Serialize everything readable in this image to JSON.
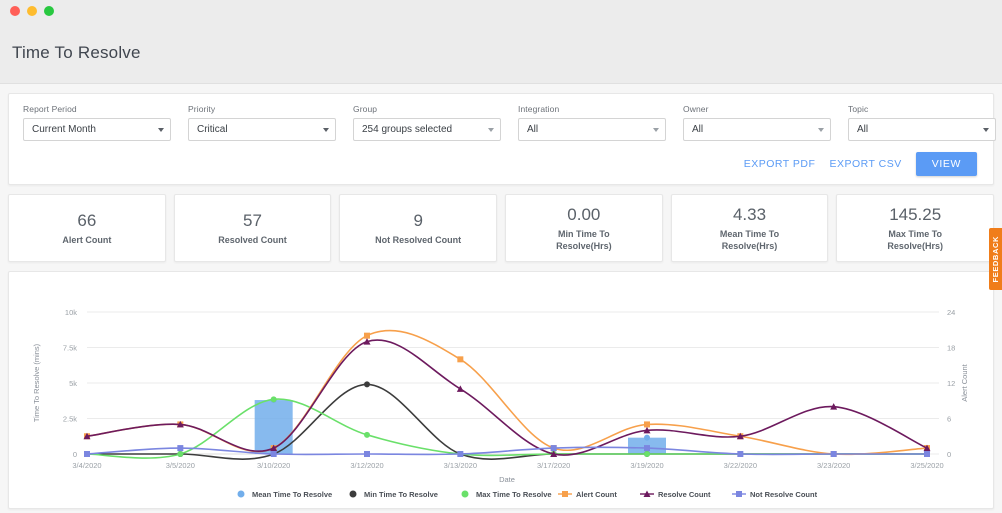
{
  "window": {
    "title": "Time To Resolve",
    "controls": [
      "close",
      "minimize",
      "maximize"
    ]
  },
  "filters": [
    {
      "label": "Report Period",
      "value": "Current Month",
      "caret": "dark"
    },
    {
      "label": "Priority",
      "value": "Critical",
      "caret": "dark"
    },
    {
      "label": "Group",
      "value": "254 groups selected",
      "caret": "light"
    },
    {
      "label": "Integration",
      "value": "All",
      "caret": "light"
    },
    {
      "label": "Owner",
      "value": "All",
      "caret": "light"
    },
    {
      "label": "Topic",
      "value": "All",
      "caret": "dark"
    }
  ],
  "actions": {
    "export_pdf": "EXPORT PDF",
    "export_csv": "EXPORT CSV",
    "view": "VIEW"
  },
  "kpis": [
    {
      "value": "66",
      "label": "Alert Count"
    },
    {
      "value": "57",
      "label": "Resolved Count"
    },
    {
      "value": "9",
      "label": "Not Resolved Count"
    },
    {
      "value": "0.00",
      "label": "Min Time To\nResolve(Hrs)"
    },
    {
      "value": "4.33",
      "label": "Mean Time To\nResolve(Hrs)"
    },
    {
      "value": "145.25",
      "label": "Max Time To\nResolve(Hrs)"
    }
  ],
  "feedback_tab": {
    "label": "FEEDBACK",
    "color": "#f07d1a"
  },
  "chart_data": {
    "type": "line",
    "title": "",
    "xlabel": "Date",
    "ylabel": "Time To Resolve (mins)",
    "y2label": "Alert Count",
    "grid": true,
    "legend_position": "bottom",
    "categories": [
      "3/4/2020",
      "3/5/2020",
      "3/10/2020",
      "3/12/2020",
      "3/13/2020",
      "3/17/2020",
      "3/19/2020",
      "3/22/2020",
      "3/23/2020",
      "3/25/2020"
    ],
    "ylim": [
      0,
      10000
    ],
    "yticks": [
      "0",
      "2.5k",
      "5k",
      "7.5k",
      "10k"
    ],
    "y2lim": [
      0,
      24
    ],
    "y2ticks": [
      "0",
      "6",
      "12",
      "18",
      "24"
    ],
    "series": [
      {
        "name": "Mean Time To Resolve",
        "color": "#72aeeb",
        "type": "bar",
        "marker": "circle",
        "axis": "left",
        "values": [
          0,
          0,
          3800,
          0,
          0,
          0,
          1150,
          0,
          0,
          0
        ]
      },
      {
        "name": "Min Time To Resolve",
        "color": "#3c3c3c",
        "type": "spline",
        "marker": "circle",
        "axis": "left",
        "values": [
          0,
          0,
          0,
          4900,
          0,
          0,
          0,
          0,
          0,
          0
        ]
      },
      {
        "name": "Max Time To Resolve",
        "color": "#6ae06a",
        "type": "spline",
        "marker": "circle",
        "axis": "left",
        "values": [
          0,
          0,
          3850,
          1350,
          0,
          0,
          0,
          0,
          0,
          0
        ]
      },
      {
        "name": "Alert Count",
        "color": "#f7a04b",
        "type": "spline",
        "marker": "square",
        "axis": "right",
        "values": [
          3,
          5,
          1,
          20,
          16,
          1,
          5,
          3,
          0,
          1
        ]
      },
      {
        "name": "Resolve Count",
        "color": "#6d1a5e",
        "type": "spline",
        "marker": "triangle",
        "axis": "right",
        "values": [
          3,
          5,
          1,
          19,
          11,
          0,
          4,
          3,
          8,
          1
        ]
      },
      {
        "name": "Not Resolve Count",
        "color": "#7b86e0",
        "type": "spline",
        "marker": "square",
        "axis": "right",
        "values": [
          0,
          1,
          0,
          0,
          0,
          1,
          1,
          0,
          0,
          0
        ]
      }
    ]
  }
}
